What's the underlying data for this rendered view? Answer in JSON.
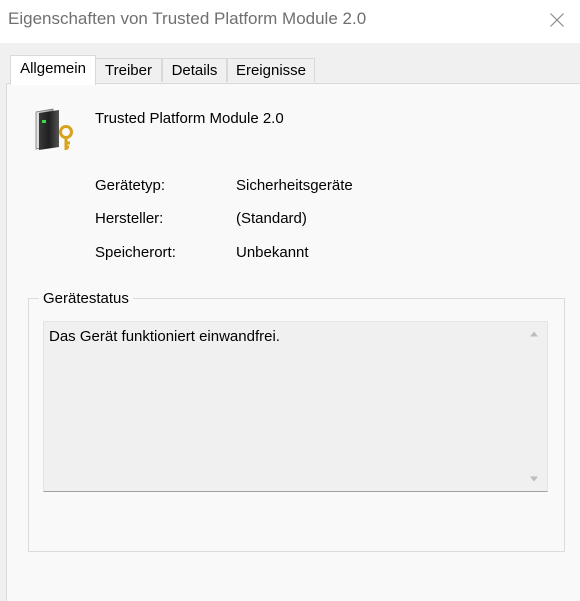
{
  "window": {
    "title": "Eigenschaften von Trusted Platform Module 2.0"
  },
  "tabs": [
    {
      "label": "Allgemein",
      "active": true
    },
    {
      "label": "Treiber",
      "active": false
    },
    {
      "label": "Details",
      "active": false
    },
    {
      "label": "Ereignisse",
      "active": false
    }
  ],
  "device": {
    "name": "Trusted Platform Module 2.0",
    "icon": "tpm-security-device-icon"
  },
  "properties": [
    {
      "label": "Gerätetyp:",
      "value": "Sicherheitsgeräte"
    },
    {
      "label": "Hersteller:",
      "value": "(Standard)"
    },
    {
      "label": "Speicherort:",
      "value": "Unbekannt"
    }
  ],
  "status_group": {
    "label": "Gerätestatus",
    "text": "Das Gerät funktioniert einwandfrei."
  },
  "colors": {
    "title_text": "#707070",
    "client_bg": "#f0f0f0",
    "page_bg": "#f9f9f9"
  }
}
